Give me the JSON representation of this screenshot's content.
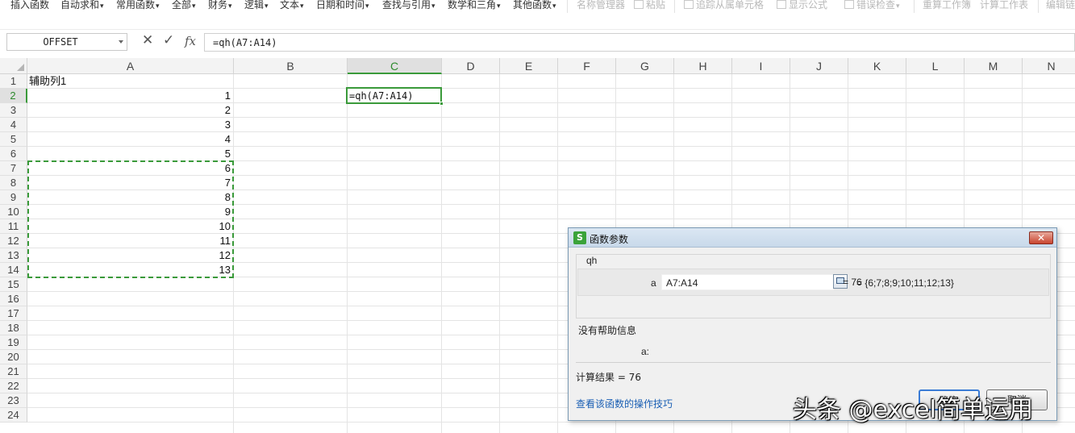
{
  "ribbon": {
    "items": [
      {
        "label": "插入函数",
        "disabled": false
      },
      {
        "label": "自动求和",
        "disabled": false,
        "dropdown": true
      },
      {
        "label": "常用函数",
        "disabled": false,
        "dropdown": true
      },
      {
        "label": "全部",
        "disabled": false,
        "dropdown": true
      },
      {
        "label": "财务",
        "disabled": false,
        "dropdown": true
      },
      {
        "label": "逻辑",
        "disabled": false,
        "dropdown": true
      },
      {
        "label": "文本",
        "disabled": false,
        "dropdown": true
      },
      {
        "label": "日期和时间",
        "disabled": false,
        "dropdown": true
      },
      {
        "label": "查找与引用",
        "disabled": false,
        "dropdown": true
      },
      {
        "label": "数学和三角",
        "disabled": false,
        "dropdown": true
      },
      {
        "label": "其他函数",
        "disabled": false,
        "dropdown": true
      },
      {
        "label": "名称管理器",
        "disabled": true
      },
      {
        "label": "粘贴",
        "disabled": true
      },
      {
        "label": "追踪从属单元格",
        "disabled": true
      },
      {
        "label": "显示公式",
        "disabled": true
      },
      {
        "label": "错误检查",
        "disabled": true,
        "dropdown": true
      },
      {
        "label": "重算工作簿",
        "disabled": true
      },
      {
        "label": "计算工作表",
        "disabled": true
      },
      {
        "label": "编辑链",
        "disabled": true
      }
    ]
  },
  "formula_bar": {
    "name_box": "OFFSET",
    "cancel_icon": "✕",
    "confirm_icon": "✓",
    "fx_label": "fx",
    "formula": "=qh(A7:A14)"
  },
  "columns": [
    "A",
    "B",
    "C",
    "D",
    "E",
    "F",
    "G",
    "H",
    "I",
    "J",
    "K",
    "L",
    "M",
    "N"
  ],
  "selected_column": "C",
  "rows": [
    "1",
    "2",
    "3",
    "4",
    "5",
    "6",
    "7",
    "8",
    "9",
    "10",
    "11",
    "12",
    "13",
    "14",
    "15",
    "16",
    "17",
    "18",
    "19",
    "20",
    "21",
    "22",
    "23",
    "24"
  ],
  "selected_row": "2",
  "cells": {
    "A1": "辅助列1",
    "A2": "1",
    "A3": "2",
    "A4": "3",
    "A5": "4",
    "A6": "5",
    "A7": "6",
    "A8": "7",
    "A9": "8",
    "A10": "9",
    "A11": "10",
    "A12": "11",
    "A13": "12",
    "A14": "13",
    "C2": "=qh(A7:A14)"
  },
  "dialog": {
    "title": "函数参数",
    "logo": "S",
    "close_label": "✕",
    "function_name": "qh",
    "arg_label": "a",
    "arg_value": "A7:A14",
    "arg_result": "=  {6;7;8;9;10;11;12;13}",
    "function_result": "=  76",
    "no_help": "没有帮助信息",
    "arg_desc": "a:",
    "calc_result": "计算结果  =  76",
    "help_link": "查看该函数的操作技巧",
    "ok_label": "确定",
    "cancel_label": "取消"
  },
  "watermark": "头条 @excel简单运用",
  "colors": {
    "accent_green": "#3a9a3a",
    "link_blue": "#1a5fb4"
  }
}
